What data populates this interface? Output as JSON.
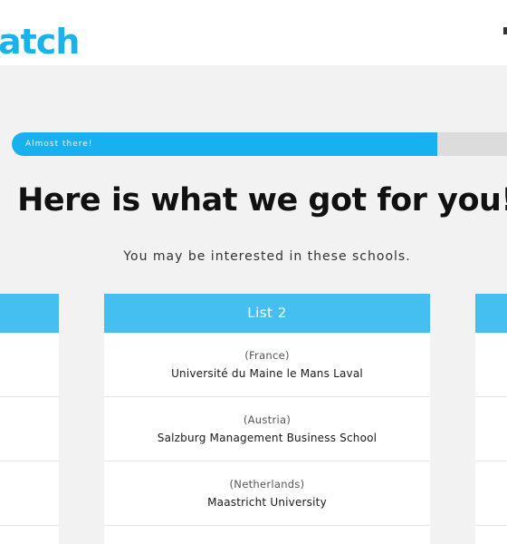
{
  "header": {
    "logo_text": "atch"
  },
  "progress": {
    "label": "Almost there!",
    "value_percent": 84
  },
  "main": {
    "title": "Here is what we got for you!",
    "subtitle": "You may be interested in these schools."
  },
  "lists": [
    {
      "title": "List 2",
      "schools": [
        {
          "country": "(France)",
          "name": "Université du Maine le Mans Laval"
        },
        {
          "country": "(Austria)",
          "name": "Salzburg Management Business School"
        },
        {
          "country": "(Netherlands)",
          "name": "Maastricht University"
        }
      ]
    }
  ],
  "colors": {
    "brand": "#1ab2ea",
    "column_header": "#45bff0",
    "progress_fill": "#16b1ee",
    "progress_track": "#dcdcdc",
    "background": "#f2f2f2"
  }
}
